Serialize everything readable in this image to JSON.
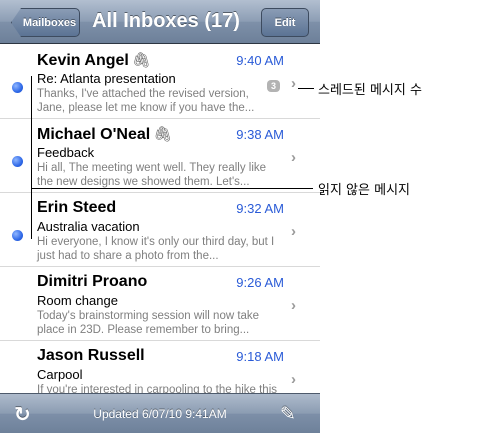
{
  "navbar": {
    "back_label": "Mailboxes",
    "title": "All Inboxes (17)",
    "edit_label": "Edit"
  },
  "messages": [
    {
      "sender": "Kevin Angel",
      "has_attachment": true,
      "time": "9:40 AM",
      "subject": "Re: Atlanta presentation",
      "preview": "Thanks, I've attached the revised version, Jane, please let me know if you have the...",
      "unread": true,
      "thread_count": "3"
    },
    {
      "sender": "Michael O'Neal",
      "has_attachment": true,
      "time": "9:38 AM",
      "subject": "Feedback",
      "preview": "Hi all, The meeting went well. They really like the new designs we showed them. Let's...",
      "unread": true,
      "thread_count": ""
    },
    {
      "sender": "Erin Steed",
      "has_attachment": false,
      "time": "9:32 AM",
      "subject": "Australia vacation",
      "preview": "Hi everyone, I know it's only our third day, but I just had to share a photo from the...",
      "unread": true,
      "thread_count": ""
    },
    {
      "sender": "Dimitri Proano",
      "has_attachment": false,
      "time": "9:26 AM",
      "subject": "Room change",
      "preview": "Today's brainstorming session will now take place in 23D. Please remember to bring...",
      "unread": false,
      "thread_count": ""
    },
    {
      "sender": "Jason Russell",
      "has_attachment": false,
      "time": "9:18 AM",
      "subject": "Carpool",
      "preview": "If you're interested in carpooling to the hike this weekend, please let me know...",
      "unread": false,
      "thread_count": ""
    }
  ],
  "toolbar": {
    "updated_text": "Updated 6/07/10 9:41AM"
  },
  "icons": {
    "attachment": "paperclip-icon",
    "refresh": "refresh-icon",
    "compose": "compose-icon",
    "chevron": "chevron-right-icon",
    "unread": "unread-dot-icon"
  },
  "callouts": {
    "threaded": "스레드된 메시지 수",
    "unread": "읽지 않은 메시지"
  },
  "glyphs": {
    "clip": "🖇",
    "chevron": "›",
    "refresh": "↻",
    "compose": "✎"
  }
}
